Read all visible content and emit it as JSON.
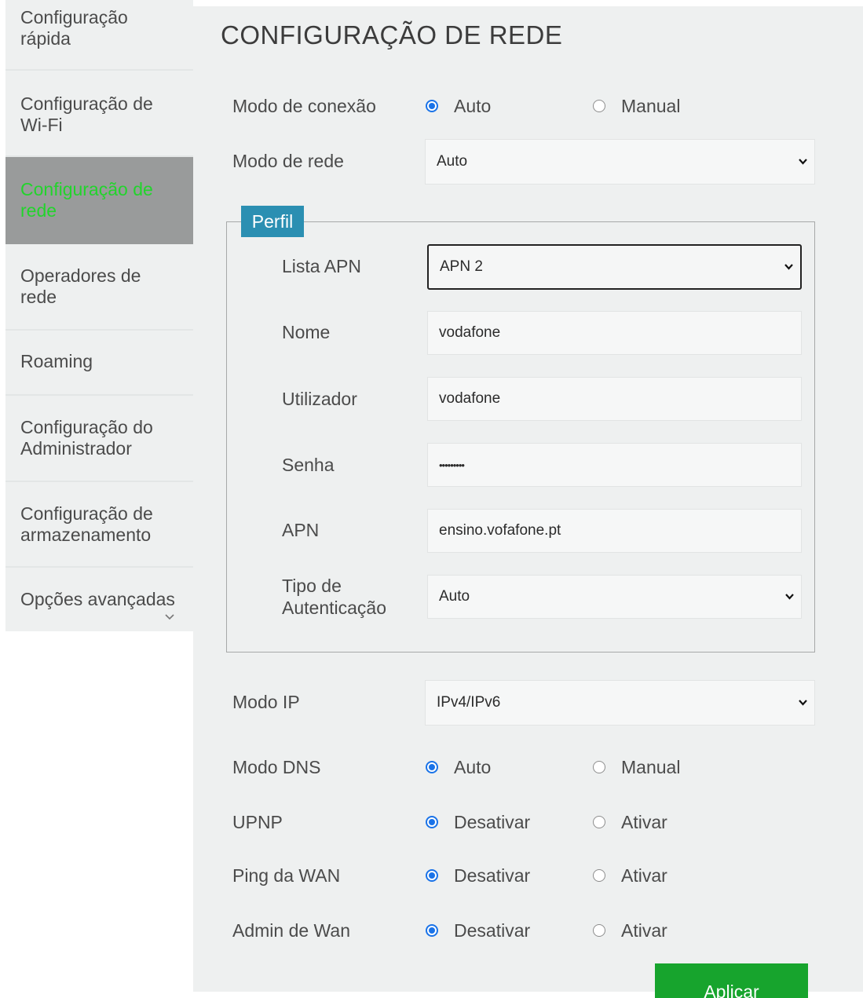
{
  "sidebar": {
    "items": [
      {
        "label": "Configuração rápida"
      },
      {
        "label": "Configuração de Wi-Fi"
      },
      {
        "label": "Configuração de rede"
      },
      {
        "label": "Operadores de rede"
      },
      {
        "label": "Roaming"
      },
      {
        "label": "Configuração do Administrador"
      },
      {
        "label": "Configuração de armazenamento"
      },
      {
        "label": "Opções avançadas"
      }
    ],
    "active_index": 2,
    "active_color": "#22d42c"
  },
  "main": {
    "title": "CONFIGURAÇÃO DE REDE",
    "connection_mode": {
      "label": "Modo de conexão",
      "opt1": "Auto",
      "opt2": "Manual",
      "selected": "Auto"
    },
    "network_mode": {
      "label": "Modo de rede",
      "value": "Auto"
    },
    "profile": {
      "legend": "Perfil",
      "apn_list": {
        "label": "Lista APN",
        "value": "APN 2"
      },
      "name": {
        "label": "Nome",
        "value": "vodafone"
      },
      "user": {
        "label": "Utilizador",
        "value": "vodafone"
      },
      "password": {
        "label": "Senha",
        "value": "•••••••••"
      },
      "apn": {
        "label": "APN",
        "value": "ensino.vofafone.pt"
      },
      "auth_type": {
        "label": "Tipo de Autenticação",
        "value": "Auto"
      }
    },
    "ip_mode": {
      "label": "Modo IP",
      "value": "IPv4/IPv6"
    },
    "dns_mode": {
      "label": "Modo DNS",
      "opt1": "Auto",
      "opt2": "Manual",
      "selected": "Auto"
    },
    "upnp": {
      "label": "UPNP",
      "opt1": "Desativar",
      "opt2": "Ativar",
      "selected": "Desativar"
    },
    "wan_ping": {
      "label": "Ping da WAN",
      "opt1": "Desativar",
      "opt2": "Ativar",
      "selected": "Desativar"
    },
    "wan_admin": {
      "label": "Admin de Wan",
      "opt1": "Desativar",
      "opt2": "Ativar",
      "selected": "Desativar"
    },
    "apply_label": "Aplicar"
  },
  "colors": {
    "radio_selected": "#1a73e8",
    "legend_bg": "#2b8fb2",
    "apply_bg": "#17a42d",
    "sidebar_active_bg": "#999b9b"
  },
  "icons": {
    "select_chevron": "chevron-down-icon",
    "radio_checked": "radio-checked-icon",
    "radio_unchecked": "radio-unchecked-icon"
  }
}
